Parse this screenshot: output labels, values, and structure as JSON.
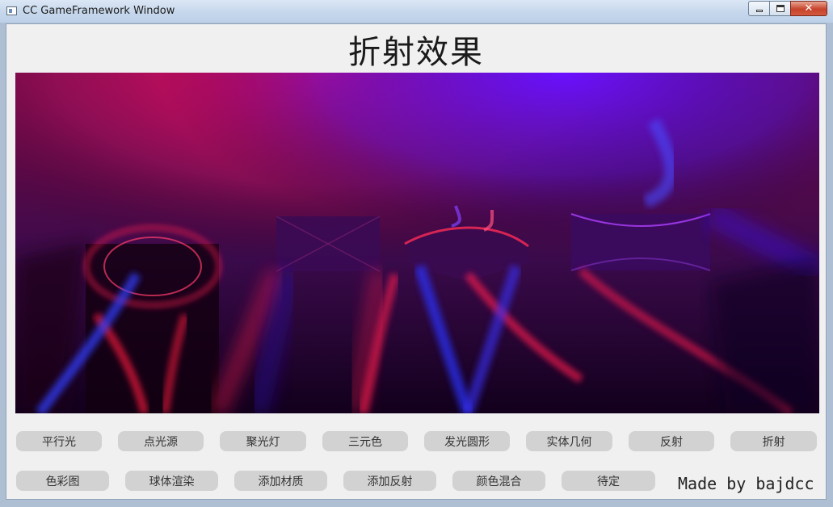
{
  "window": {
    "title": "CC GameFramework Window",
    "close_glyph": "✕"
  },
  "page": {
    "title": "折射效果"
  },
  "buttons_row1": [
    {
      "label": "平行光"
    },
    {
      "label": "点光源"
    },
    {
      "label": "聚光灯"
    },
    {
      "label": "三元色"
    },
    {
      "label": "发光圆形"
    },
    {
      "label": "实体几何"
    },
    {
      "label": "反射"
    },
    {
      "label": "折射"
    }
  ],
  "buttons_row2": [
    {
      "label": "色彩图"
    },
    {
      "label": "球体渲染"
    },
    {
      "label": "添加材质"
    },
    {
      "label": "添加反射"
    },
    {
      "label": "颜色混合"
    },
    {
      "label": "待定"
    }
  ],
  "footer": {
    "signature": "Made by bajdcc"
  },
  "colors": {
    "light_red": "#ff1460",
    "light_blue": "#5a10ff",
    "canvas_dark": "#230014"
  }
}
